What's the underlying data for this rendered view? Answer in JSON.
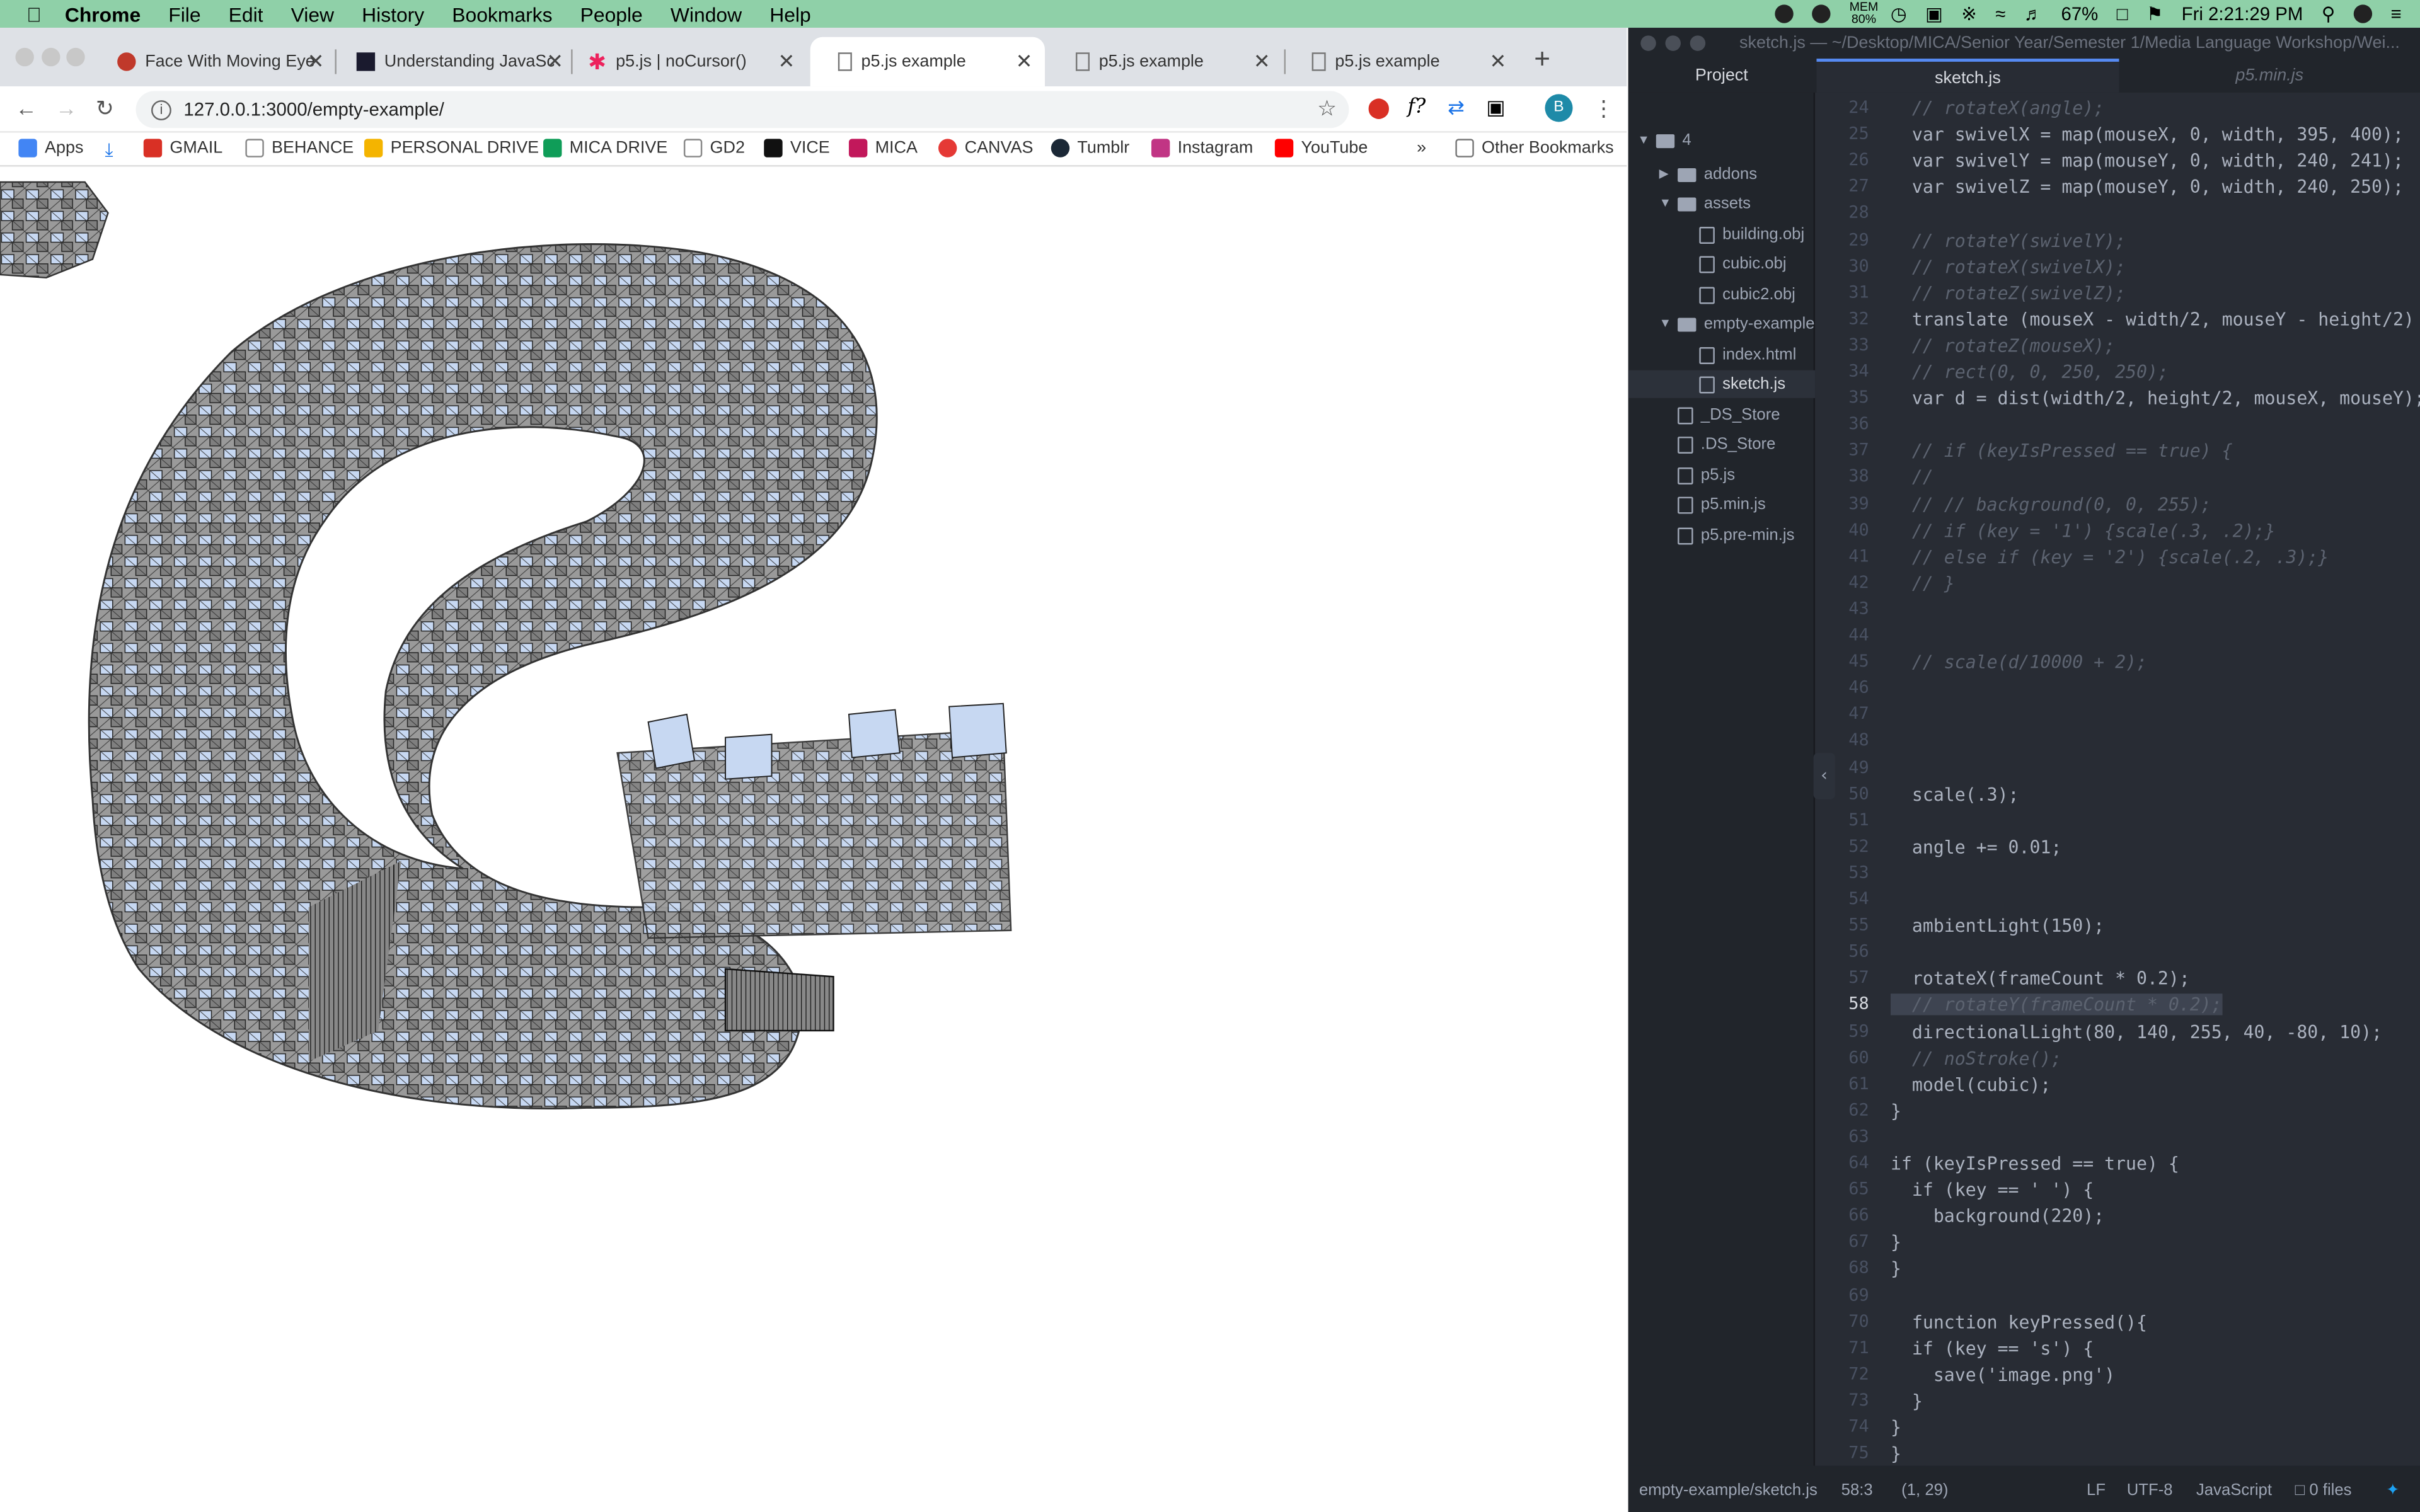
{
  "menubar": {
    "app": "Chrome",
    "items": [
      "File",
      "Edit",
      "View",
      "History",
      "Bookmarks",
      "People",
      "Window",
      "Help"
    ],
    "mem_label": "MEM",
    "mem_value": "80%",
    "battery": "67%",
    "clock": "Fri 2:21:29 PM"
  },
  "browser": {
    "tabs": [
      {
        "title": "Face With Moving Eye",
        "favicon_color": "#c0392b"
      },
      {
        "title": "Understanding JavaScri",
        "favicon_color": "#1a1a2e"
      },
      {
        "title": "p5.js | noCursor()",
        "favicon_color": "#ed225d"
      },
      {
        "title": "p5.js example",
        "favicon_color": "#888888",
        "active": true
      },
      {
        "title": "p5.js example",
        "favicon_color": "#888888"
      },
      {
        "title": "p5.js example",
        "favicon_color": "#888888"
      }
    ],
    "url": "127.0.0.1:3000/empty-example/",
    "avatar_letter": "B",
    "bookmarks": [
      {
        "label": "Apps",
        "color": "#4285f4"
      },
      {
        "label": "",
        "color": "#1a73e8"
      },
      {
        "label": "GMAIL",
        "color": "#d93025"
      },
      {
        "label": "BEHANCE",
        "color": "#888888"
      },
      {
        "label": "PERSONAL DRIVE",
        "color": "#f4b400"
      },
      {
        "label": "MICA DRIVE",
        "color": "#0f9d58"
      },
      {
        "label": "GD2",
        "color": "#888888"
      },
      {
        "label": "VICE",
        "color": "#111111"
      },
      {
        "label": "MICA",
        "color": "#c2185b"
      },
      {
        "label": "CANVAS",
        "color": "#e53935"
      },
      {
        "label": "Tumblr",
        "color": "#1b2836"
      },
      {
        "label": "Instagram",
        "color": "#c13584"
      },
      {
        "label": "YouTube",
        "color": "#ff0000"
      }
    ],
    "more": "»",
    "other_bookmarks": "Other Bookmarks"
  },
  "editor": {
    "window_title": "sketch.js — ~/Desktop/MICA/Senior Year/Semester 1/Media Language Workshop/Wei...",
    "panel_tab": "Project",
    "tabs": [
      {
        "title": "sketch.js",
        "active": true
      },
      {
        "title": "p5.min.js",
        "active": false
      }
    ],
    "tree": [
      {
        "label": "4",
        "type": "folder",
        "depth": 0,
        "open": true
      },
      {
        "label": "addons",
        "type": "folder",
        "depth": 1,
        "open": false
      },
      {
        "label": "assets",
        "type": "folder",
        "depth": 1,
        "open": true
      },
      {
        "label": "building.obj",
        "type": "file",
        "depth": 2
      },
      {
        "label": "cubic.obj",
        "type": "file",
        "depth": 2
      },
      {
        "label": "cubic2.obj",
        "type": "file",
        "depth": 2
      },
      {
        "label": "empty-example",
        "type": "folder",
        "depth": 1,
        "open": true
      },
      {
        "label": "index.html",
        "type": "file",
        "depth": 2
      },
      {
        "label": "sketch.js",
        "type": "file",
        "depth": 2,
        "selected": true
      },
      {
        "label": "_DS_Store",
        "type": "file",
        "depth": 1
      },
      {
        "label": ".DS_Store",
        "type": "file",
        "depth": 1
      },
      {
        "label": "p5.js",
        "type": "file",
        "depth": 1
      },
      {
        "label": "p5.min.js",
        "type": "file",
        "depth": 1
      },
      {
        "label": "p5.pre-min.js",
        "type": "file",
        "depth": 1
      }
    ],
    "current_line": 58,
    "lines": [
      {
        "n": 24,
        "text": "  // rotateX(angle);",
        "comment": true
      },
      {
        "n": 25,
        "text": "  var swivelX = map(mouseX, 0, width, 395, 400);"
      },
      {
        "n": 26,
        "text": "  var swivelY = map(mouseY, 0, width, 240, 241);"
      },
      {
        "n": 27,
        "text": "  var swivelZ = map(mouseY, 0, width, 240, 250);"
      },
      {
        "n": 28,
        "text": ""
      },
      {
        "n": 29,
        "text": "  // rotateY(swivelY);",
        "comment": true
      },
      {
        "n": 30,
        "text": "  // rotateX(swivelX);",
        "comment": true
      },
      {
        "n": 31,
        "text": "  // rotateZ(swivelZ);",
        "comment": true
      },
      {
        "n": 32,
        "text": "  translate (mouseX - width/2, mouseY - height/2)"
      },
      {
        "n": 33,
        "text": "  // rotateZ(mouseX);",
        "comment": true
      },
      {
        "n": 34,
        "text": "  // rect(0, 0, 250, 250);",
        "comment": true
      },
      {
        "n": 35,
        "text": "  var d = dist(width/2, height/2, mouseX, mouseY);"
      },
      {
        "n": 36,
        "text": ""
      },
      {
        "n": 37,
        "text": "  // if (keyIsPressed == true) {",
        "comment": true
      },
      {
        "n": 38,
        "text": "  //",
        "comment": true
      },
      {
        "n": 39,
        "text": "  // // background(0, 0, 255);",
        "comment": true
      },
      {
        "n": 40,
        "text": "  // if (key = '1') {scale(.3, .2);}",
        "comment": true
      },
      {
        "n": 41,
        "text": "  // else if (key = '2') {scale(.2, .3);}",
        "comment": true
      },
      {
        "n": 42,
        "text": "  // }",
        "comment": true
      },
      {
        "n": 43,
        "text": ""
      },
      {
        "n": 44,
        "text": ""
      },
      {
        "n": 45,
        "text": "  // scale(d/10000 + 2);",
        "comment": true
      },
      {
        "n": 46,
        "text": ""
      },
      {
        "n": 47,
        "text": ""
      },
      {
        "n": 48,
        "text": ""
      },
      {
        "n": 49,
        "text": ""
      },
      {
        "n": 50,
        "text": "  scale(.3);"
      },
      {
        "n": 51,
        "text": ""
      },
      {
        "n": 52,
        "text": "  angle += 0.01;"
      },
      {
        "n": 53,
        "text": ""
      },
      {
        "n": 54,
        "text": ""
      },
      {
        "n": 55,
        "text": "  ambientLight(150);"
      },
      {
        "n": 56,
        "text": ""
      },
      {
        "n": 57,
        "text": "  rotateX(frameCount * 0.2);"
      },
      {
        "n": 58,
        "text": "  // rotateY(frameCount * 0.2);",
        "comment": true,
        "highlight": true
      },
      {
        "n": 59,
        "text": "  directionalLight(80, 140, 255, 40, -80, 10);"
      },
      {
        "n": 60,
        "text": "  // noStroke();",
        "comment": true
      },
      {
        "n": 61,
        "text": "  model(cubic);"
      },
      {
        "n": 62,
        "text": "}"
      },
      {
        "n": 63,
        "text": ""
      },
      {
        "n": 64,
        "text": "if (keyIsPressed == true) {"
      },
      {
        "n": 65,
        "text": "  if (key == ' ') {"
      },
      {
        "n": 66,
        "text": "    background(220);"
      },
      {
        "n": 67,
        "text": "}"
      },
      {
        "n": 68,
        "text": "}"
      },
      {
        "n": 69,
        "text": ""
      },
      {
        "n": 70,
        "text": "  function keyPressed(){"
      },
      {
        "n": 71,
        "text": "  if (key == 's') {"
      },
      {
        "n": 72,
        "text": "    save('image.png')"
      },
      {
        "n": 73,
        "text": "  }"
      },
      {
        "n": 74,
        "text": "}"
      },
      {
        "n": 75,
        "text": "}"
      }
    ],
    "status": {
      "path": "empty-example/sketch.js",
      "cursor": "58:3",
      "selection": "(1, 29)",
      "line_ending": "LF",
      "encoding": "UTF-8",
      "grammar": "JavaScript",
      "files": "0 files"
    }
  }
}
